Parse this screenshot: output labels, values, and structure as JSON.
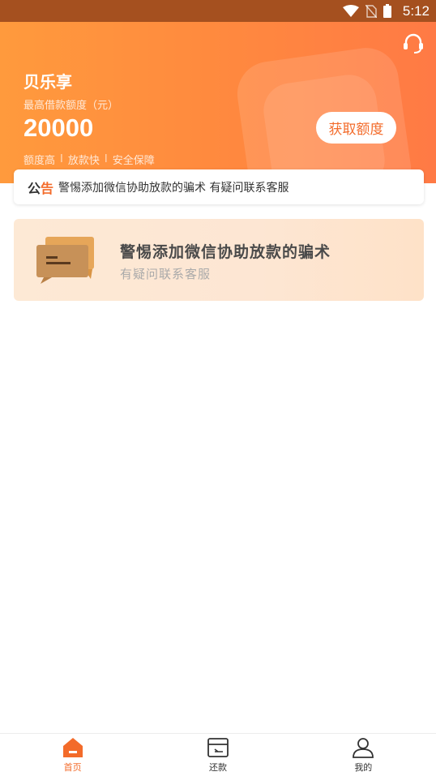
{
  "status_bar": {
    "time": "5:12"
  },
  "header": {
    "app_name": "贝乐享",
    "limit_label": "最高借款额度（元）",
    "limit_amount": "20000",
    "features": [
      "额度高",
      "放款快",
      "安全保障"
    ],
    "separator": "I",
    "get_limit_label": "获取额度"
  },
  "notice": {
    "tag_part1": "公",
    "tag_part2": "告",
    "text": "警惕添加微信协助放款的骗术 有疑问联系客服"
  },
  "banner": {
    "title": "警惕添加微信协助放款的骗术",
    "subtitle": "有疑问联系客服"
  },
  "tabs": [
    {
      "label": "首页",
      "icon": "home-icon",
      "active": true
    },
    {
      "label": "还款",
      "icon": "repay-icon",
      "active": false
    },
    {
      "label": "我的",
      "icon": "user-icon",
      "active": false
    }
  ],
  "colors": {
    "accent": "#f36b2a",
    "header_start": "#ff9a3d",
    "header_end": "#ff7a45"
  }
}
